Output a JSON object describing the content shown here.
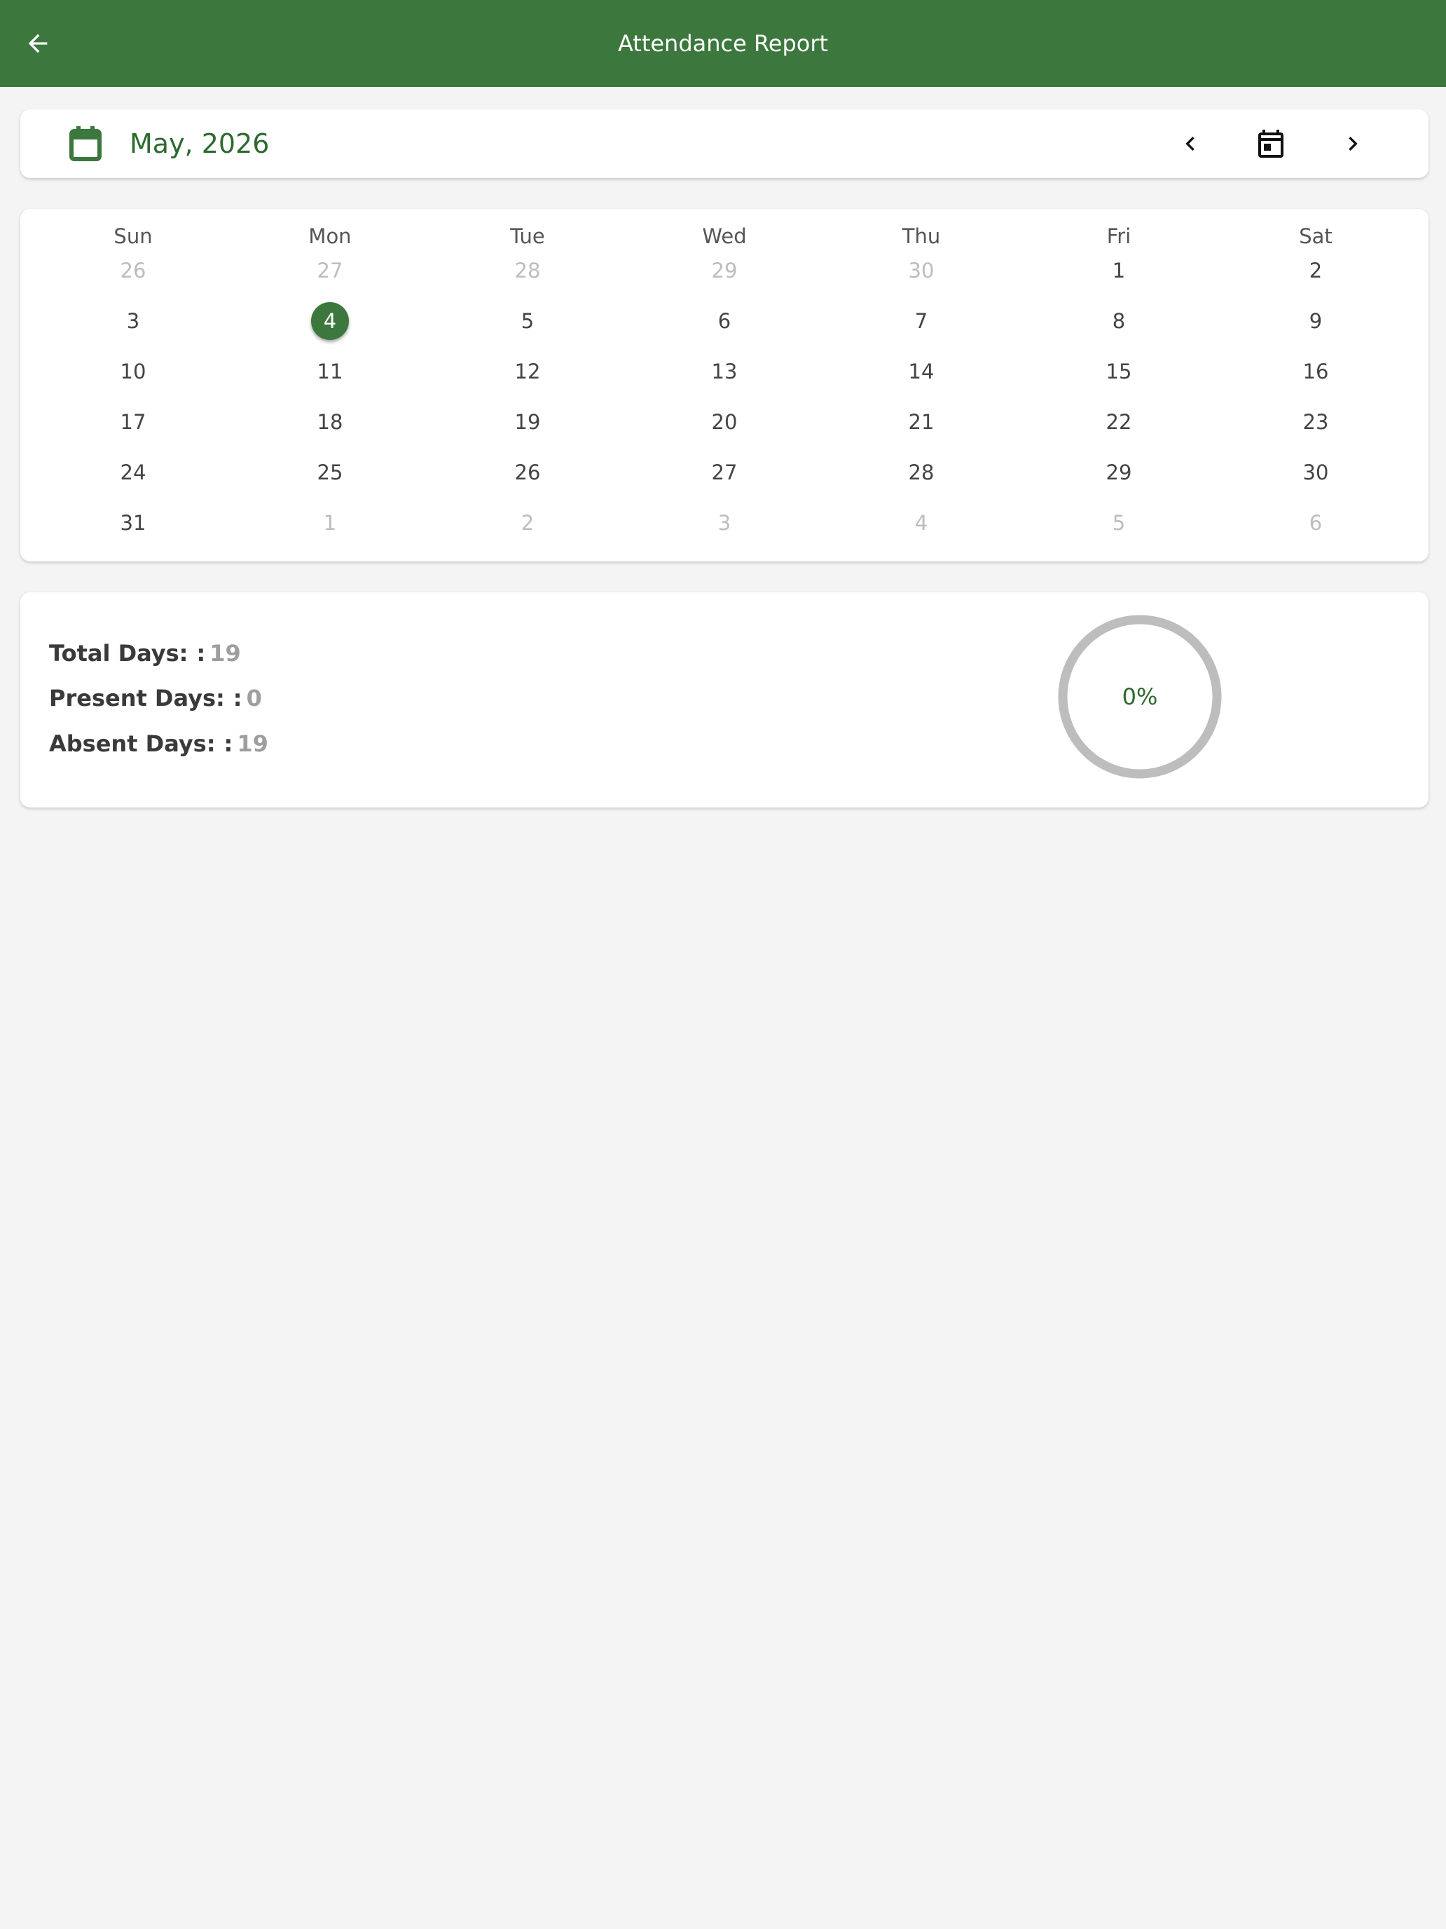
{
  "appbar": {
    "title": "Attendance Report",
    "back_icon": "arrow-left-icon"
  },
  "month_selector": {
    "label": "May, 2026",
    "icons": {
      "calendar": "calendar-icon",
      "prev": "chevron-left-icon",
      "today": "calendar-today-icon",
      "next": "chevron-right-icon"
    }
  },
  "calendar": {
    "weekdays": [
      "Sun",
      "Mon",
      "Tue",
      "Wed",
      "Thu",
      "Fri",
      "Sat"
    ],
    "selected_day": 4,
    "weeks": [
      [
        {
          "d": "26",
          "o": true
        },
        {
          "d": "27",
          "o": true
        },
        {
          "d": "28",
          "o": true
        },
        {
          "d": "29",
          "o": true
        },
        {
          "d": "30",
          "o": true
        },
        {
          "d": "1",
          "o": false
        },
        {
          "d": "2",
          "o": false
        }
      ],
      [
        {
          "d": "3",
          "o": false
        },
        {
          "d": "4",
          "o": false
        },
        {
          "d": "5",
          "o": false
        },
        {
          "d": "6",
          "o": false
        },
        {
          "d": "7",
          "o": false
        },
        {
          "d": "8",
          "o": false
        },
        {
          "d": "9",
          "o": false
        }
      ],
      [
        {
          "d": "10",
          "o": false
        },
        {
          "d": "11",
          "o": false
        },
        {
          "d": "12",
          "o": false
        },
        {
          "d": "13",
          "o": false
        },
        {
          "d": "14",
          "o": false
        },
        {
          "d": "15",
          "o": false
        },
        {
          "d": "16",
          "o": false
        }
      ],
      [
        {
          "d": "17",
          "o": false
        },
        {
          "d": "18",
          "o": false
        },
        {
          "d": "19",
          "o": false
        },
        {
          "d": "20",
          "o": false
        },
        {
          "d": "21",
          "o": false
        },
        {
          "d": "22",
          "o": false
        },
        {
          "d": "23",
          "o": false
        }
      ],
      [
        {
          "d": "24",
          "o": false
        },
        {
          "d": "25",
          "o": false
        },
        {
          "d": "26",
          "o": false
        },
        {
          "d": "27",
          "o": false
        },
        {
          "d": "28",
          "o": false
        },
        {
          "d": "29",
          "o": false
        },
        {
          "d": "30",
          "o": false
        }
      ],
      [
        {
          "d": "31",
          "o": false
        },
        {
          "d": "1",
          "o": true
        },
        {
          "d": "2",
          "o": true
        },
        {
          "d": "3",
          "o": true
        },
        {
          "d": "4",
          "o": true
        },
        {
          "d": "5",
          "o": true
        },
        {
          "d": "6",
          "o": true
        }
      ]
    ]
  },
  "stats": {
    "total": {
      "label": "Total Days:",
      "sep": ":",
      "value": "19"
    },
    "present": {
      "label": "Present Days:",
      "sep": ":",
      "value": "0"
    },
    "absent": {
      "label": "Absent Days:",
      "sep": ":",
      "value": "19"
    },
    "progress": {
      "text": "0%",
      "fraction": 0
    }
  },
  "colors": {
    "primary": "#3c773d",
    "primary_text": "#2e6a2f",
    "ring_track": "#bdbdbd",
    "background": "#f4f4f4"
  }
}
